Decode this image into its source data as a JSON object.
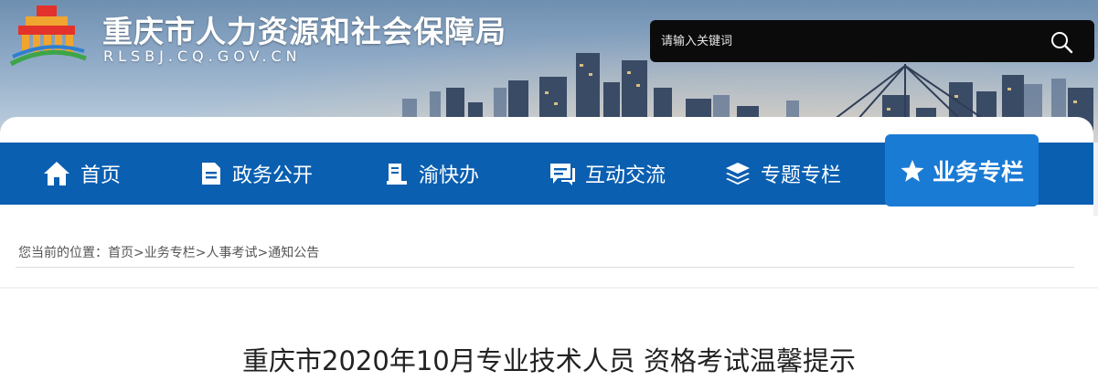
{
  "header": {
    "title": "重庆市人力资源和社会保障局",
    "domain": "RLSBJ.CQ.GOV.CN",
    "logo_icon": "government-building-logo"
  },
  "search": {
    "placeholder": "请输入关键词",
    "icon": "search-icon"
  },
  "nav": {
    "items": [
      {
        "label": "首页",
        "icon": "home-icon"
      },
      {
        "label": "政务公开",
        "icon": "document-icon"
      },
      {
        "label": "渝快办",
        "icon": "book-icon"
      },
      {
        "label": "互动交流",
        "icon": "chat-icon"
      },
      {
        "label": "专题专栏",
        "icon": "layers-icon"
      },
      {
        "label": "业务专栏",
        "icon": "star-icon",
        "active": true
      }
    ]
  },
  "breadcrumb": {
    "prefix": "您当前的位置：",
    "items": [
      "首页",
      "业务专栏",
      "人事考试",
      "通知公告"
    ],
    "separator": ">"
  },
  "article": {
    "title": "重庆市2020年10月专业技术人员 资格考试温馨提示"
  },
  "colors": {
    "nav_bg": "#0a5fb1",
    "nav_active_bg": "#1a7bd4",
    "search_bg": "#0b0b0b"
  }
}
